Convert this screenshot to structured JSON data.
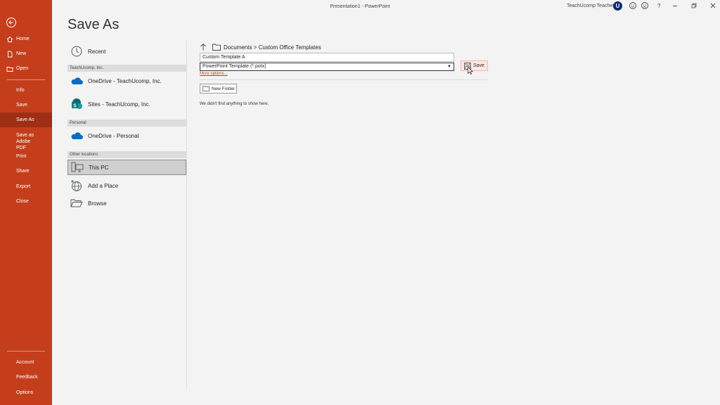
{
  "window": {
    "title": "Presentation1  -  PowerPoint",
    "user": "TeachUcomp Teacher",
    "avatar_letter": "U",
    "help": "?"
  },
  "nav": {
    "items": [
      {
        "label": "Home",
        "icon": "home-icon"
      },
      {
        "label": "New",
        "icon": "new-file-icon"
      },
      {
        "label": "Open",
        "icon": "open-folder-icon"
      },
      {
        "label": "Info"
      },
      {
        "label": "Save"
      },
      {
        "label": "Save As"
      },
      {
        "label": "Save as Adobe PDF"
      },
      {
        "label": "Print"
      },
      {
        "label": "Share"
      },
      {
        "label": "Export"
      },
      {
        "label": "Close"
      },
      {
        "label": "Account"
      },
      {
        "label": "Feedback"
      },
      {
        "label": "Options"
      }
    ],
    "active": "Save As"
  },
  "page": {
    "title": "Save As"
  },
  "locations": {
    "recent": "Recent",
    "group_org": "TeachUcomp, Inc.",
    "onedrive_org": "OneDrive - TeachUcomp, Inc.",
    "sites_org": "Sites - TeachUcomp, Inc.",
    "group_personal": "Personal",
    "onedrive_personal": "OneDrive - Personal",
    "group_other": "Other locations",
    "this_pc": "This PC",
    "add_place": "Add a Place",
    "browse": "Browse"
  },
  "save_pane": {
    "breadcrumb": "Documents > Custom Office Templates",
    "file_name": "Custom Template A",
    "file_type": "PowerPoint Template (*.potx)",
    "more_options": "More options...",
    "save_label": "Save",
    "new_folder_label": "New Folder",
    "empty_message": "We didn't find anything to show here."
  },
  "colors": {
    "accent": "#c43e1c",
    "accent_dark": "#9e2f14",
    "onedrive_blue": "#0f6cbd",
    "sharepoint_teal": "#037c74"
  }
}
